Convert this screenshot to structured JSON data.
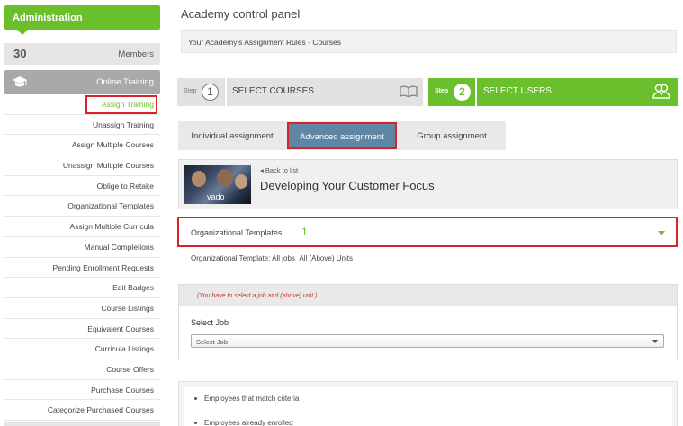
{
  "sidebar": {
    "admin_title": "Administration",
    "members_label": "Members",
    "online_training_label": "Online Training",
    "items": [
      {
        "label": "Assign Training",
        "active": true
      },
      {
        "label": "Unassign Training"
      },
      {
        "label": "Assign Multiple Courses"
      },
      {
        "label": "Unassign Multiple Courses"
      },
      {
        "label": "Oblige to Retake"
      },
      {
        "label": "Organizational Templates"
      },
      {
        "label": "Assign Multiple Curricula"
      },
      {
        "label": "Manual Completions"
      },
      {
        "label": "Pending Enrollment Requests"
      },
      {
        "label": "Edit Badges"
      },
      {
        "label": "Course Listings"
      },
      {
        "label": "Equivalent Courses"
      },
      {
        "label": "Curricula Listings"
      },
      {
        "label": "Course Offers"
      },
      {
        "label": "Purchase Courses"
      },
      {
        "label": "Categorize Purchased Courses"
      }
    ]
  },
  "main": {
    "title": "Academy control panel",
    "rules_title": "Your Academy's Assignment Rules - Courses",
    "steps": [
      {
        "word": "Step",
        "number": "1",
        "label": "SELECT COURSES"
      },
      {
        "word": "Step",
        "number": "2",
        "label": "SELECT USERS"
      }
    ],
    "tabs": [
      {
        "label": "Individual assignment"
      },
      {
        "label": "Advanced assignment"
      },
      {
        "label": "Group assignment"
      }
    ],
    "course": {
      "thumb_logo": "vado",
      "back_link": "Back to list",
      "title": "Developing Your Customer Focus"
    },
    "org_templates": {
      "label": "Organizational Templates:",
      "count": "1",
      "note": "Organizational Template: All jobs_All (Above) Units"
    },
    "job": {
      "warning": "(You have to select a job and (above) unit.)",
      "select_label": "Select Job",
      "select_value": "Select Job"
    },
    "employees": [
      "Employees that match criteria",
      "Employees already enrolled"
    ]
  },
  "colors": {
    "accent_green": "#6cbf2c",
    "tab_active": "#6086a6",
    "highlight_red": "#d9222a"
  }
}
